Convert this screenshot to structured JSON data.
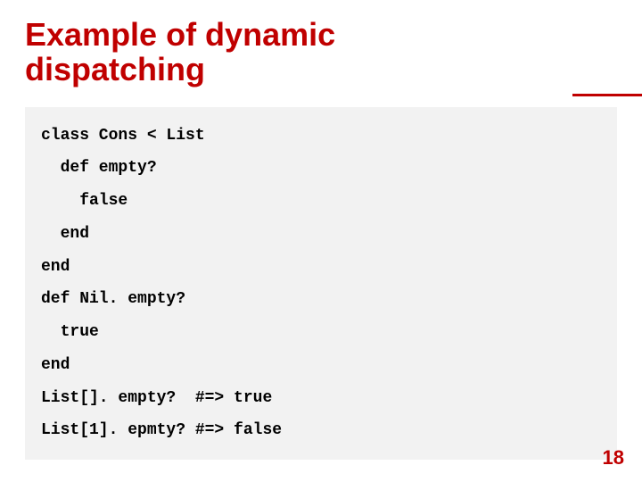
{
  "title_line1": "Example of dynamic",
  "title_line2": "dispatching",
  "code": {
    "l1": "class Cons < List",
    "l2": "  def empty?",
    "l3": "    false",
    "l4": "  end",
    "l5": "end",
    "l6": "def Nil. empty?",
    "l7": "  true",
    "l8": "end",
    "l9": "List[]. empty?  #=> true",
    "l10": "List[1]. epmty? #=> false"
  },
  "page_number": "18"
}
